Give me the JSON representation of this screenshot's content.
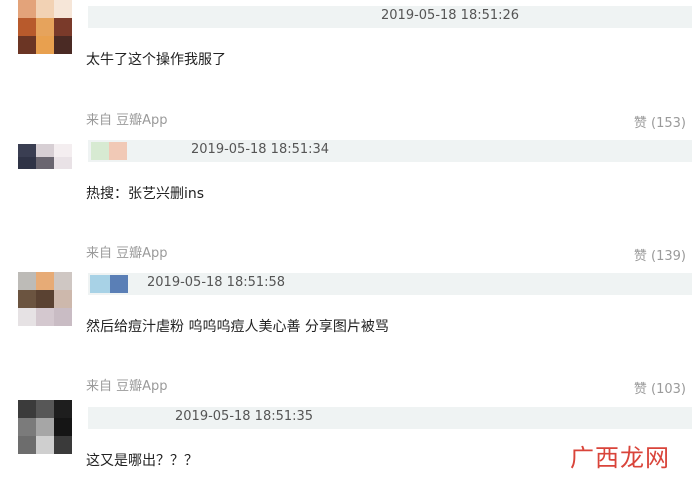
{
  "comments": [
    {
      "timestamp": "2019-05-18 18:51:26",
      "text": "太牛了这个操作我服了",
      "source": "来自 豆瓣App",
      "likes": "赞 (153)"
    },
    {
      "timestamp": "2019-05-18 18:51:34",
      "text": "热搜：张艺兴删ins",
      "source": "来自 豆瓣App",
      "likes": "赞 (139)"
    },
    {
      "timestamp": "2019-05-18 18:51:58",
      "text": "然后给痘汁虐粉 呜呜呜痘人美心善 分享图片被骂",
      "source": "来自 豆瓣App",
      "likes": "赞 (103)"
    },
    {
      "timestamp": "2019-05-18 18:51:35",
      "text": "这又是哪出？？？"
    }
  ],
  "watermark": "广西龙网",
  "colors": {
    "name_bar": "#eff3f3",
    "watermark": "#d9443a",
    "meta_text": "#9a9a9a"
  }
}
